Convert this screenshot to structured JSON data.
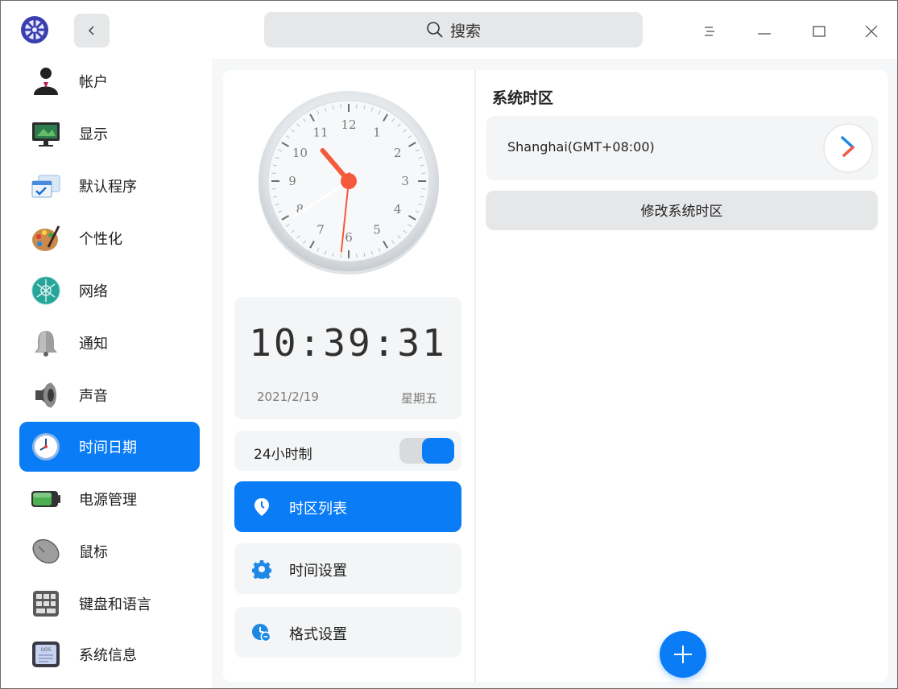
{
  "titlebar": {
    "search_label": "搜索",
    "icons": [
      "app-logo",
      "chevron-left-icon",
      "search-icon",
      "menu-icon",
      "minimize-icon",
      "maximize-icon",
      "close-icon"
    ]
  },
  "sidebar": {
    "items": [
      {
        "label": "帐户",
        "icon": "account-icon"
      },
      {
        "label": "显示",
        "icon": "display-icon"
      },
      {
        "label": "默认程序",
        "icon": "default-apps-icon"
      },
      {
        "label": "个性化",
        "icon": "personalization-icon"
      },
      {
        "label": "网络",
        "icon": "network-icon"
      },
      {
        "label": "通知",
        "icon": "bell-icon"
      },
      {
        "label": "声音",
        "icon": "speaker-icon"
      },
      {
        "label": "时间日期",
        "icon": "clock-icon",
        "active": true
      },
      {
        "label": "电源管理",
        "icon": "battery-icon"
      },
      {
        "label": "鼠标",
        "icon": "mouse-icon"
      },
      {
        "label": "键盘和语言",
        "icon": "keyboard-icon"
      },
      {
        "label": "系统信息",
        "icon": "system-info-icon"
      }
    ]
  },
  "clock": {
    "time": "10:39:31",
    "date": "2021/2/19",
    "weekday": "星期五",
    "numbers": [
      "12",
      "1",
      "2",
      "3",
      "4",
      "5",
      "6",
      "7",
      "8",
      "9",
      "10",
      "11"
    ]
  },
  "settings": {
    "hour24_label": "24小时制",
    "hour24_enabled": true,
    "nav": [
      {
        "label": "时区列表",
        "icon": "location-pin-icon",
        "active": true
      },
      {
        "label": "时间设置",
        "icon": "gear-icon"
      },
      {
        "label": "格式设置",
        "icon": "format-icon"
      }
    ]
  },
  "timezone": {
    "title": "系统时区",
    "current": "Shanghai(GMT+08:00)",
    "change_label": "修改系统时区",
    "add_label": "+"
  },
  "colors": {
    "accent": "#0a7cf6",
    "clock_hand": "#f55a3d",
    "panel_bg": "#f4f5f6",
    "button_bg": "#e6e7e9"
  }
}
